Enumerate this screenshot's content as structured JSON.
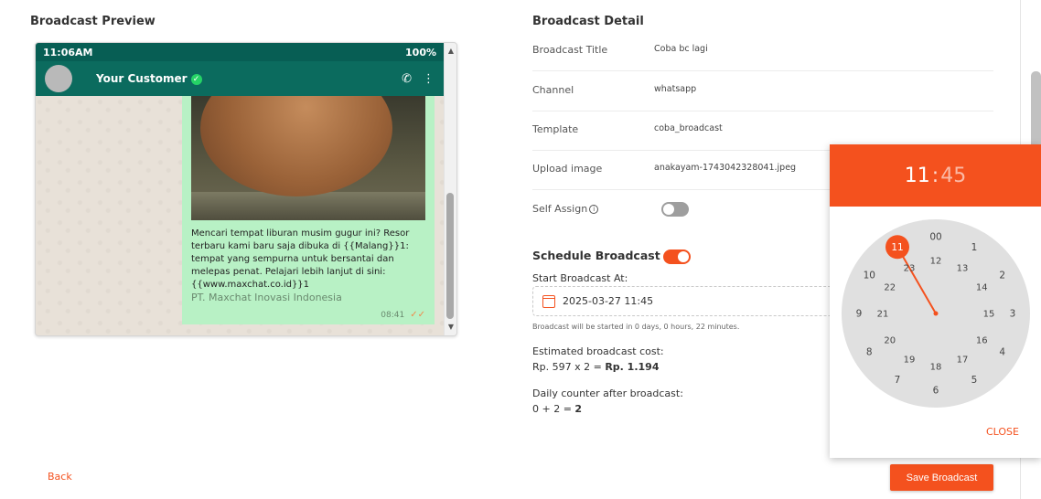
{
  "preview": {
    "title": "Broadcast Preview",
    "status_time": "11:06AM",
    "battery": "100%",
    "contact_name": "Your Customer",
    "message_text": "Mencari tempat liburan musim gugur ini? Resor terbaru kami baru saja dibuka di {{Malang}}1: tempat yang sempurna untuk bersantai dan melepas penat. Pelajari lebih lanjut di sini: {{www.maxchat.co.id}}1",
    "footer": "PT. Maxchat Inovasi Indonesia",
    "message_time": "08:41"
  },
  "detail": {
    "title": "Broadcast Detail",
    "rows": [
      {
        "label": "Broadcast Title",
        "value": "Coba bc lagi"
      },
      {
        "label": "Channel",
        "value": "whatsapp"
      },
      {
        "label": "Template",
        "value": "coba_broadcast"
      },
      {
        "label": "Upload image",
        "value": "anakayam-1743042328041.jpeg"
      }
    ],
    "self_assign_label": "Self Assign",
    "self_assign_on": false,
    "schedule_label": "Schedule Broadcast",
    "schedule_on": true,
    "start_label": "Start Broadcast At:",
    "start_value": "2025-03-27 11:45",
    "start_hint": "Broadcast will be started in 0 days, 0 hours, 22 minutes.",
    "cost_label": "Estimated broadcast cost:",
    "cost_formula": "Rp. 597 x 2 = ",
    "cost_total": "Rp. 1.194",
    "counter_label": "Daily counter after broadcast:",
    "counter_formula": "0 + 2 = ",
    "counter_total": "2"
  },
  "actions": {
    "back": "Back",
    "save": "Save Broadcast"
  },
  "time_picker": {
    "hour": "11",
    "minute": "45",
    "outer_hours": [
      "00",
      "1",
      "2",
      "3",
      "4",
      "5",
      "6",
      "7",
      "8",
      "9",
      "10",
      "11"
    ],
    "inner_hours": [
      "12",
      "13",
      "14",
      "15",
      "16",
      "17",
      "18",
      "19",
      "20",
      "21",
      "22",
      "23"
    ],
    "selected_hour": "11",
    "close": "CLOSE"
  },
  "colors": {
    "accent": "#f4511e",
    "wa_header": "#075e54",
    "bubble": "#b8f1c5"
  }
}
